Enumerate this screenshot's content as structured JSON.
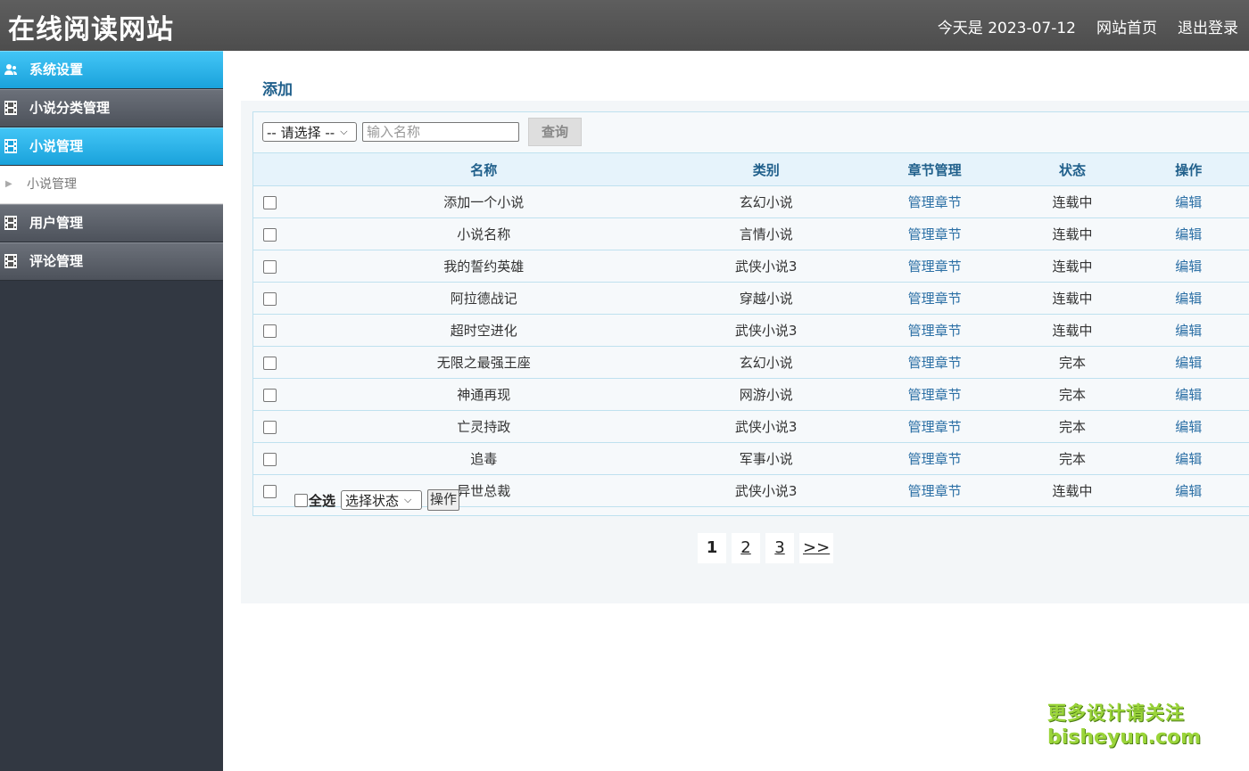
{
  "header": {
    "site_title": "在线阅读网站",
    "date_text": "今天是 2023-07-12",
    "home_link": "网站首页",
    "logout_link": "退出登录"
  },
  "sidebar": {
    "items": [
      {
        "label": "系统设置",
        "icon": "users-icon",
        "active": true
      },
      {
        "label": "小说分类管理",
        "icon": "film-icon",
        "active": false
      },
      {
        "label": "小说管理",
        "icon": "film-icon",
        "active": true
      },
      {
        "label": "用户管理",
        "icon": "film-icon",
        "active": false
      },
      {
        "label": "评论管理",
        "icon": "film-icon",
        "active": false
      }
    ],
    "submenu": {
      "label": "小说管理"
    }
  },
  "main": {
    "add_label": "添加",
    "toolbar": {
      "select_value": "-- 请选择 --",
      "search_placeholder": "输入名称",
      "query_label": "查询"
    },
    "table": {
      "headers": [
        "名称",
        "类别",
        "章节管理",
        "状态",
        "操作"
      ],
      "rows": [
        {
          "name": "添加一个小说",
          "category": "玄幻小说",
          "chapters": "管理章节",
          "status": "连载中",
          "action": "编辑"
        },
        {
          "name": "小说名称",
          "category": "言情小说",
          "chapters": "管理章节",
          "status": "连载中",
          "action": "编辑"
        },
        {
          "name": "我的誓约英雄",
          "category": "武侠小说3",
          "chapters": "管理章节",
          "status": "连载中",
          "action": "编辑"
        },
        {
          "name": "阿拉德战记",
          "category": "穿越小说",
          "chapters": "管理章节",
          "status": "连载中",
          "action": "编辑"
        },
        {
          "name": "超时空进化",
          "category": "武侠小说3",
          "chapters": "管理章节",
          "status": "连载中",
          "action": "编辑"
        },
        {
          "name": "无限之最强王座",
          "category": "玄幻小说",
          "chapters": "管理章节",
          "status": "完本",
          "action": "编辑"
        },
        {
          "name": "神通再现",
          "category": "网游小说",
          "chapters": "管理章节",
          "status": "完本",
          "action": "编辑"
        },
        {
          "name": "亡灵持政",
          "category": "武侠小说3",
          "chapters": "管理章节",
          "status": "完本",
          "action": "编辑"
        },
        {
          "name": "追毒",
          "category": "军事小说",
          "chapters": "管理章节",
          "status": "完本",
          "action": "编辑"
        },
        {
          "name": "异世总裁",
          "category": "武侠小说3",
          "chapters": "管理章节",
          "status": "连载中",
          "action": "编辑"
        }
      ]
    },
    "footer": {
      "select_all": "全选",
      "status_select": "选择状态",
      "op_button": "操作"
    },
    "pager": {
      "current": "1",
      "pages": [
        "2",
        "3"
      ],
      "next": ">>"
    }
  },
  "watermark": {
    "line1": "更多设计请关注",
    "line2": "bisheyun.com"
  },
  "colors": {
    "header_bg": "#555555",
    "sidebar_bg": "#323842",
    "active_menu": "#29b3e8",
    "link": "#2b6fa5"
  }
}
